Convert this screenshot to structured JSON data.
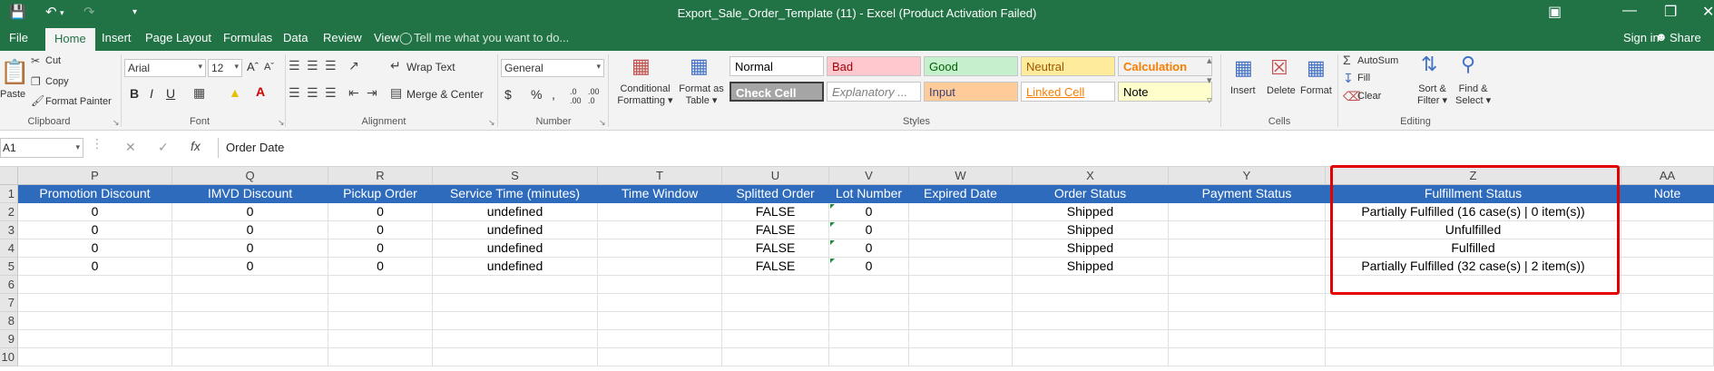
{
  "titlebar": {
    "title": "Export_Sale_Order_Template (11) - Excel (Product Activation Failed)",
    "icons": [
      "save-icon",
      "undo-icon",
      "redo-icon",
      "customize-icon",
      "ribbon-display-icon",
      "minimize-icon",
      "restore-icon",
      "close-icon"
    ]
  },
  "tabs": [
    "File",
    "Home",
    "Insert",
    "Page Layout",
    "Formulas",
    "Data",
    "Review",
    "View"
  ],
  "active_tab": "Home",
  "tell_me": "Tell me what you want to do...",
  "signin": "Sign in",
  "share": "Share",
  "ribbon": {
    "clipboard": {
      "label": "Clipboard",
      "paste": "Paste",
      "cut": "Cut",
      "copy": "Copy",
      "format_painter": "Format Painter"
    },
    "font": {
      "label": "Font",
      "name": "Arial",
      "size": "12",
      "bold": "B",
      "italic": "I",
      "underline": "U"
    },
    "alignment": {
      "label": "Alignment",
      "wrap": "Wrap Text",
      "merge": "Merge & Center"
    },
    "number": {
      "label": "Number",
      "format": "General",
      "currency": "$",
      "percent": "%",
      "comma": ","
    },
    "styles": {
      "label": "Styles",
      "conditional_1": "Conditional",
      "conditional_2": "Formatting",
      "format_table_1": "Format as",
      "format_table_2": "Table",
      "cells": [
        {
          "text": "Normal",
          "bg": "#ffffff",
          "fg": "#000000"
        },
        {
          "text": "Bad",
          "bg": "#ffc7ce",
          "fg": "#9c0006"
        },
        {
          "text": "Good",
          "bg": "#c6efce",
          "fg": "#006100"
        },
        {
          "text": "Neutral",
          "bg": "#ffeb9c",
          "fg": "#9c5700"
        },
        {
          "text": "Calculation",
          "bg": "#f2f2f2",
          "fg": "#fa7d00"
        },
        {
          "text": "Check Cell",
          "bg": "#a5a5a5",
          "fg": "#ffffff"
        },
        {
          "text": "Explanatory ...",
          "bg": "#ffffff",
          "fg": "#7f7f7f"
        },
        {
          "text": "Input",
          "bg": "#ffcc99",
          "fg": "#3f3f76"
        },
        {
          "text": "Linked Cell",
          "bg": "#ffffff",
          "fg": "#fa7d00"
        },
        {
          "text": "Note",
          "bg": "#ffffcc",
          "fg": "#000000"
        }
      ]
    },
    "cells": {
      "label": "Cells",
      "insert": "Insert",
      "delete": "Delete",
      "format": "Format"
    },
    "editing": {
      "label": "Editing",
      "autosum": "AutoSum",
      "fill": "Fill",
      "clear": "Clear",
      "sort_1": "Sort &",
      "sort_2": "Filter",
      "find_1": "Find &",
      "find_2": "Select"
    }
  },
  "formula_bar": {
    "name_box": "A1",
    "fx": "fx",
    "formula": "Order Date"
  },
  "grid": {
    "columns": [
      {
        "letter": "P",
        "header": "Promotion Discount"
      },
      {
        "letter": "Q",
        "header": "IMVD Discount"
      },
      {
        "letter": "R",
        "header": "Pickup Order"
      },
      {
        "letter": "S",
        "header": "Service Time (minutes)"
      },
      {
        "letter": "T",
        "header": "Time Window"
      },
      {
        "letter": "U",
        "header": "Splitted Order"
      },
      {
        "letter": "V",
        "header": "Lot Number"
      },
      {
        "letter": "W",
        "header": "Expired Date"
      },
      {
        "letter": "X",
        "header": "Order Status"
      },
      {
        "letter": "Y",
        "header": "Payment Status"
      },
      {
        "letter": "Z",
        "header": "Fulfillment Status"
      },
      {
        "letter": "AA",
        "header": "Note"
      }
    ],
    "row_numbers": [
      "1",
      "2",
      "3",
      "4",
      "5",
      "6",
      "7",
      "8",
      "9",
      "10"
    ],
    "rows": [
      [
        "0",
        "0",
        "0",
        "undefined",
        "",
        "FALSE",
        "0",
        "",
        "Shipped",
        "",
        "Partially Fulfilled (16 case(s) | 0 item(s))",
        ""
      ],
      [
        "0",
        "0",
        "0",
        "undefined",
        "",
        "FALSE",
        "0",
        "",
        "Shipped",
        "",
        "Unfulfilled",
        ""
      ],
      [
        "0",
        "0",
        "0",
        "undefined",
        "",
        "FALSE",
        "0",
        "",
        "Shipped",
        "",
        "Fulfilled",
        ""
      ],
      [
        "0",
        "0",
        "0",
        "undefined",
        "",
        "FALSE",
        "0",
        "",
        "Shipped",
        "",
        "Partially Fulfilled (32 case(s) | 2 item(s))",
        ""
      ]
    ],
    "highlight_color": "#e30000",
    "header_fill": "#2e6bbd"
  }
}
